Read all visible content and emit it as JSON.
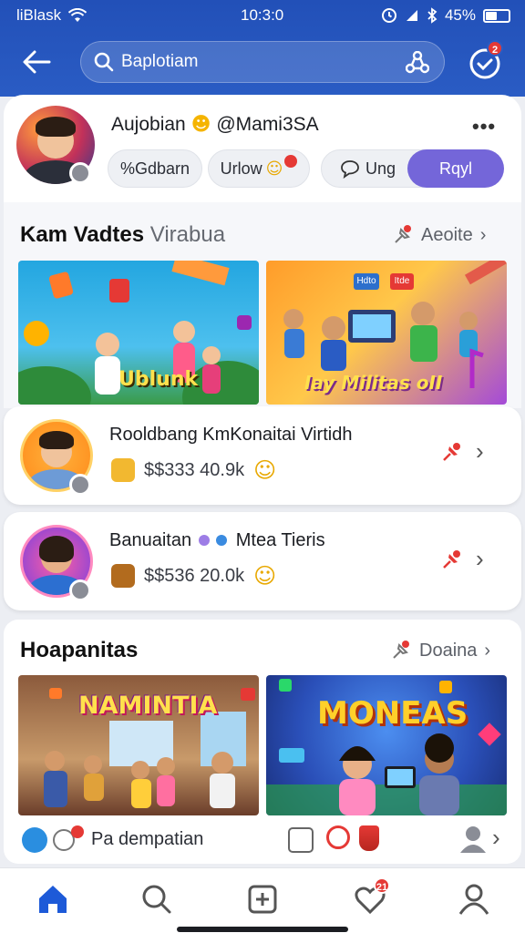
{
  "status_bar": {
    "carrier": "liBlask",
    "time": "10:3:0",
    "battery_percent": "45%"
  },
  "header": {
    "search_placeholder": "Baplotiam",
    "notification_badge": "2"
  },
  "profile": {
    "name": "Aujobian",
    "name_suffix": "@Mami3SA",
    "actions": {
      "collection": "%Gdbarn",
      "follow": "Urlow",
      "message": "Ung",
      "primary": "Rqyl"
    }
  },
  "section1": {
    "title": "Kam Vadtes",
    "subtitle": "Virabua",
    "link": "Aeoite",
    "tiles": [
      {
        "caption": "Ublunk"
      },
      {
        "caption": "Iay Militas oII",
        "sign_a": "Hdto",
        "sign_b": "Itde"
      }
    ]
  },
  "list_items": [
    {
      "title": "Rooldbang KmKonaitai Virtidh",
      "price": "$$333 40.9k"
    },
    {
      "title": "Banuaitan",
      "title_suffix": "Mtea Tieris",
      "price": "$$536 20.0k"
    }
  ],
  "section2": {
    "title": "Hoapanitas",
    "link": "Doaina",
    "tiles": [
      {
        "caption": "NAMINTIA"
      },
      {
        "caption": "MONEAS"
      }
    ],
    "footer_label": "Pa dempatian"
  },
  "bottom_nav": {
    "notification_badge": "21"
  },
  "colors": {
    "header_blue": "#2a5cc4",
    "accent_purple": "#7466d9",
    "badge_red": "#e53935"
  }
}
